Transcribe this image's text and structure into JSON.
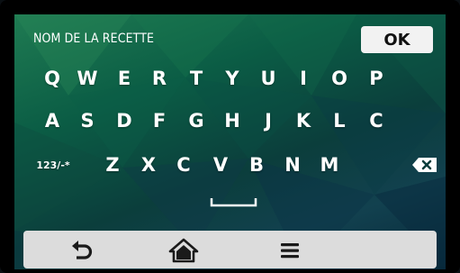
{
  "header": {
    "title": "NOM DE LA RECETTE",
    "ok_label": "OK"
  },
  "keyboard": {
    "row1": [
      "Q",
      "W",
      "E",
      "R",
      "T",
      "Y",
      "U",
      "I",
      "O",
      "P"
    ],
    "row2": [
      "A",
      "S",
      "D",
      "F",
      "G",
      "H",
      "J",
      "K",
      "L",
      "C"
    ],
    "row3": [
      "123/-*",
      "Z",
      "X",
      "C",
      "V",
      "B",
      "N",
      "M"
    ],
    "backspace_icon": "backspace-icon",
    "space_icon": "space-bar-icon"
  },
  "navbar": {
    "items": [
      {
        "icon": "back-arrow-icon"
      },
      {
        "icon": "home-icon"
      },
      {
        "icon": "menu-icon"
      }
    ]
  },
  "colors": {
    "background_gradient": [
      "#1f7b52",
      "#0b5d45",
      "#0b3e3c",
      "#12414f",
      "#07283a"
    ],
    "ok_bg": "#f2f2f2",
    "navbar_bg": "#dcdcdc",
    "icon_color": "#1a1a1a"
  }
}
